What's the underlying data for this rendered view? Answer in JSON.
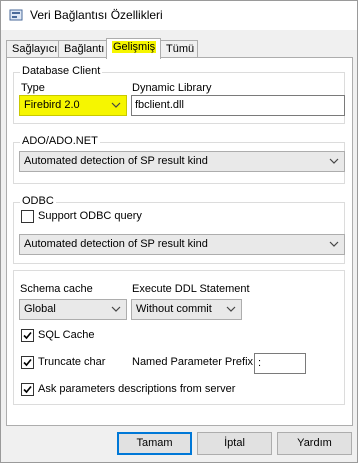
{
  "window": {
    "title": "Veri Bağlantısı Özellikleri"
  },
  "tabs": [
    {
      "label": "Sağlayıcı",
      "active": false
    },
    {
      "label": "Bağlantı",
      "active": false
    },
    {
      "label": "Gelişmiş",
      "active": true
    },
    {
      "label": "Tümü",
      "active": false
    }
  ],
  "database_client": {
    "group_label": "Database Client",
    "type_label": "Type",
    "type_value": "Firebird 2.0",
    "library_label": "Dynamic Library",
    "library_value": "fbclient.dll"
  },
  "ado": {
    "group_label": "ADO/ADO.NET",
    "sp_detection_value": "Automated detection of SP result kind"
  },
  "odbc": {
    "group_label": "ODBC",
    "support_query_label": "Support ODBC query",
    "support_query_checked": false,
    "sp_detection_value": "Automated detection of SP result kind"
  },
  "options": {
    "schema_cache_label": "Schema cache",
    "schema_cache_value": "Global",
    "ddl_label": "Execute DDL Statement",
    "ddl_value": "Without commit",
    "sql_cache_label": "SQL Cache",
    "sql_cache_checked": true,
    "truncate_char_label": "Truncate char",
    "truncate_char_checked": true,
    "named_param_prefix_label": "Named Parameter Prefix",
    "named_param_prefix_value": ":",
    "ask_params_label": "Ask parameters descriptions from server",
    "ask_params_checked": true
  },
  "buttons": {
    "ok": "Tamam",
    "cancel": "İptal",
    "help": "Yardım"
  },
  "colors": {
    "highlight": "#f6f600",
    "default_button_border": "#0078d7"
  }
}
